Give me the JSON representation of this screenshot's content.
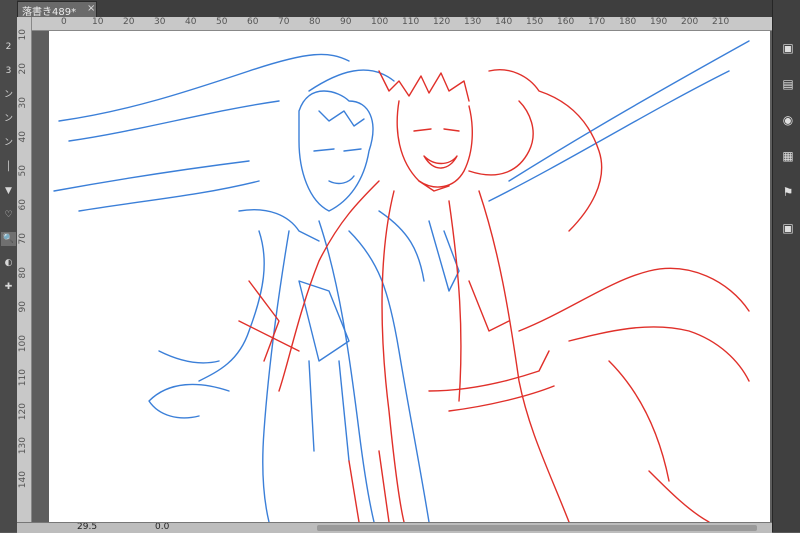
{
  "document": {
    "tab_title": "落書き489*",
    "close_glyph": "×"
  },
  "ruler": {
    "top_labels": [
      "0",
      "10",
      "20",
      "30",
      "40",
      "50",
      "60",
      "70",
      "80",
      "90",
      "100",
      "110",
      "120",
      "130",
      "140",
      "150",
      "160",
      "170",
      "180",
      "190",
      "200",
      "210"
    ],
    "left_labels": [
      "10",
      "20",
      "30",
      "40",
      "50",
      "60",
      "70",
      "80",
      "90",
      "100",
      "110",
      "120",
      "130",
      "140"
    ]
  },
  "tools": [
    {
      "glyph": "2",
      "icon": "tool-2-icon"
    },
    {
      "glyph": "3",
      "icon": "tool-3-icon"
    },
    {
      "glyph": "ン",
      "icon": "tool-n-icon"
    },
    {
      "glyph": "ン",
      "icon": "tool-n2-icon"
    },
    {
      "glyph": "ン",
      "icon": "tool-n3-icon"
    },
    {
      "glyph": "│",
      "icon": "bar-icon"
    },
    {
      "glyph": "▼",
      "icon": "bucket-icon"
    },
    {
      "glyph": "♡",
      "icon": "heart-icon"
    },
    {
      "glyph": "🔍",
      "icon": "zoom-icon"
    },
    {
      "glyph": "◐",
      "icon": "circle-icon"
    },
    {
      "glyph": "✚",
      "icon": "move-icon"
    }
  ],
  "right_panel": [
    {
      "glyph": "▣",
      "icon": "layer-folder-icon"
    },
    {
      "glyph": "▤",
      "icon": "layer-icon"
    },
    {
      "glyph": "◉",
      "icon": "target-icon"
    },
    {
      "glyph": "▦",
      "icon": "checker-icon"
    },
    {
      "glyph": "⚑",
      "icon": "flag-icon"
    },
    {
      "glyph": "▣",
      "icon": "layer-folder-2-icon"
    }
  ],
  "status": {
    "zoom": "29.5",
    "angle": "0.0"
  },
  "colors": {
    "sketch_blue": "#3b7fd8",
    "sketch_red": "#e0302a",
    "paper": "#ffffff"
  }
}
